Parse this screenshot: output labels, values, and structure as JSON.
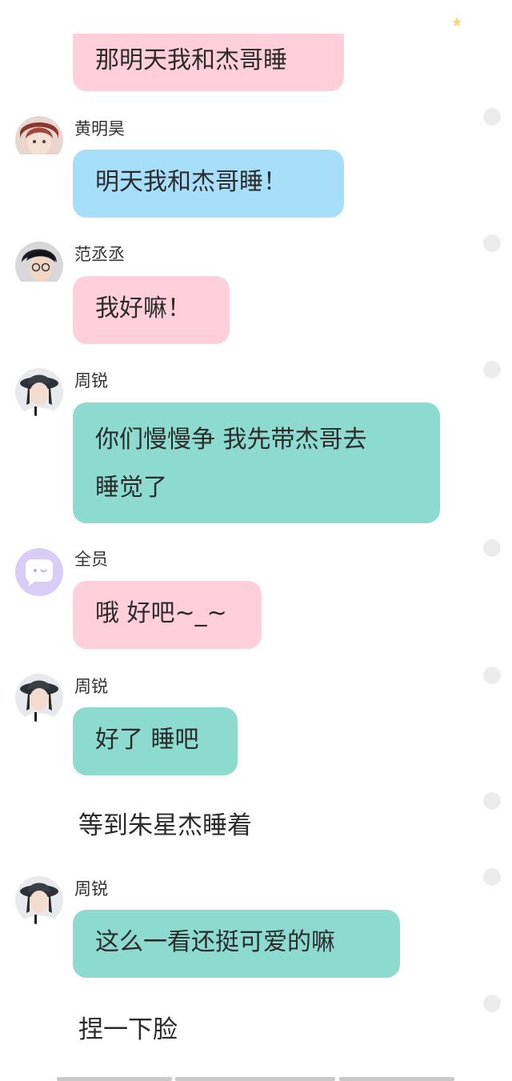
{
  "decor": {
    "star_icon": "star-icon",
    "star_color": "#f7d37a"
  },
  "colors": {
    "pink_bubble": "#ffd0dc",
    "blue_bubble": "#a7dffb",
    "teal_bubble": "#8cdad0"
  },
  "messages": [
    {
      "sender": "",
      "text": "那明天我和杰哥睡",
      "style": "pink"
    },
    {
      "sender": "黄明昊",
      "text": "明天我和杰哥睡！",
      "style": "blue",
      "avatar_icon": "boy-portrait-avatar"
    },
    {
      "sender": "范丞丞",
      "text": "我好嘛！",
      "style": "pink",
      "avatar_icon": "boy-glasses-avatar"
    },
    {
      "sender": "周锐",
      "text_line1": "你们慢慢争 我先带杰哥去",
      "text_line2": "睡觉了",
      "style": "teal",
      "avatar_icon": "girl-hat-avatar"
    },
    {
      "sender": "全员",
      "text": "哦 好吧~_~",
      "style": "pink",
      "avatar_icon": "chat-bubble-avatar"
    },
    {
      "sender": "周锐",
      "text": "好了 睡吧",
      "style": "teal",
      "avatar_icon": "girl-hat-avatar"
    },
    {
      "narration": "等到朱星杰睡着"
    },
    {
      "sender": "周锐",
      "text": "这么一看还挺可爱的嘛",
      "style": "teal",
      "avatar_icon": "girl-hat-avatar"
    },
    {
      "narration": "捏一下脸"
    }
  ]
}
